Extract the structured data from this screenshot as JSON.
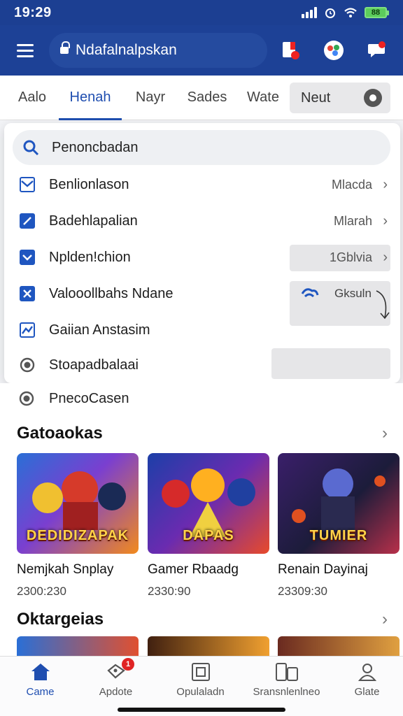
{
  "status": {
    "time": "19:29",
    "battery": "88"
  },
  "appbar": {
    "url": "Ndafalnalpskan"
  },
  "tabs": [
    "Aalo",
    "Henah",
    "Nayr",
    "Sades",
    "Wate"
  ],
  "tab_more": "Neut",
  "dropdown": {
    "search_placeholder": "Penoncbadan",
    "items": [
      {
        "label": "Benlionlason",
        "value": "Mlacda",
        "icon": "envelope-icon"
      },
      {
        "label": "Badehlapalian",
        "value": "Mlarah",
        "icon": "edit-icon"
      },
      {
        "label": "Nplden!chion",
        "value": "1Gblvia",
        "icon": "checkbox-icon"
      },
      {
        "label": "Valooollbahs Ndane",
        "value": "Gksuln",
        "icon": "close-box-icon"
      },
      {
        "label": "Gaiian Anstasim",
        "value": "",
        "icon": "chart-icon"
      },
      {
        "label": "Stoapadbalaai",
        "value": "",
        "icon": "radio-icon"
      }
    ],
    "extra_item": "PnecoCasen"
  },
  "sections": [
    {
      "title": "Gatoaokas",
      "games": [
        {
          "name": "Nemjkah Snplay",
          "count": "2300:230",
          "thumb_text": "DEDIDIZAPAK",
          "colors": [
            "#2a6fd6",
            "#f28a1c"
          ]
        },
        {
          "name": "Gamer Rbaadg",
          "count": "2330:90",
          "thumb_text": "DAPAS",
          "colors": [
            "#1c3fa8",
            "#e84a2a"
          ]
        },
        {
          "name": "Renain Dayinaj",
          "count": "23309:30",
          "thumb_text": "TUMIER",
          "colors": [
            "#3a1f6a",
            "#b8304a"
          ]
        }
      ]
    },
    {
      "title": "Oktargeias"
    }
  ],
  "bottom_nav": [
    {
      "label": "Came",
      "icon": "home-icon",
      "active": true
    },
    {
      "label": "Apdote",
      "icon": "tag-icon",
      "badge": "1"
    },
    {
      "label": "Opulaladn",
      "icon": "library-icon"
    },
    {
      "label": "Sransnlenlneo",
      "icon": "devices-icon"
    },
    {
      "label": "Glate",
      "icon": "profile-icon"
    }
  ],
  "colors": {
    "primary": "#1d4196",
    "accent": "#1f4eb0"
  }
}
